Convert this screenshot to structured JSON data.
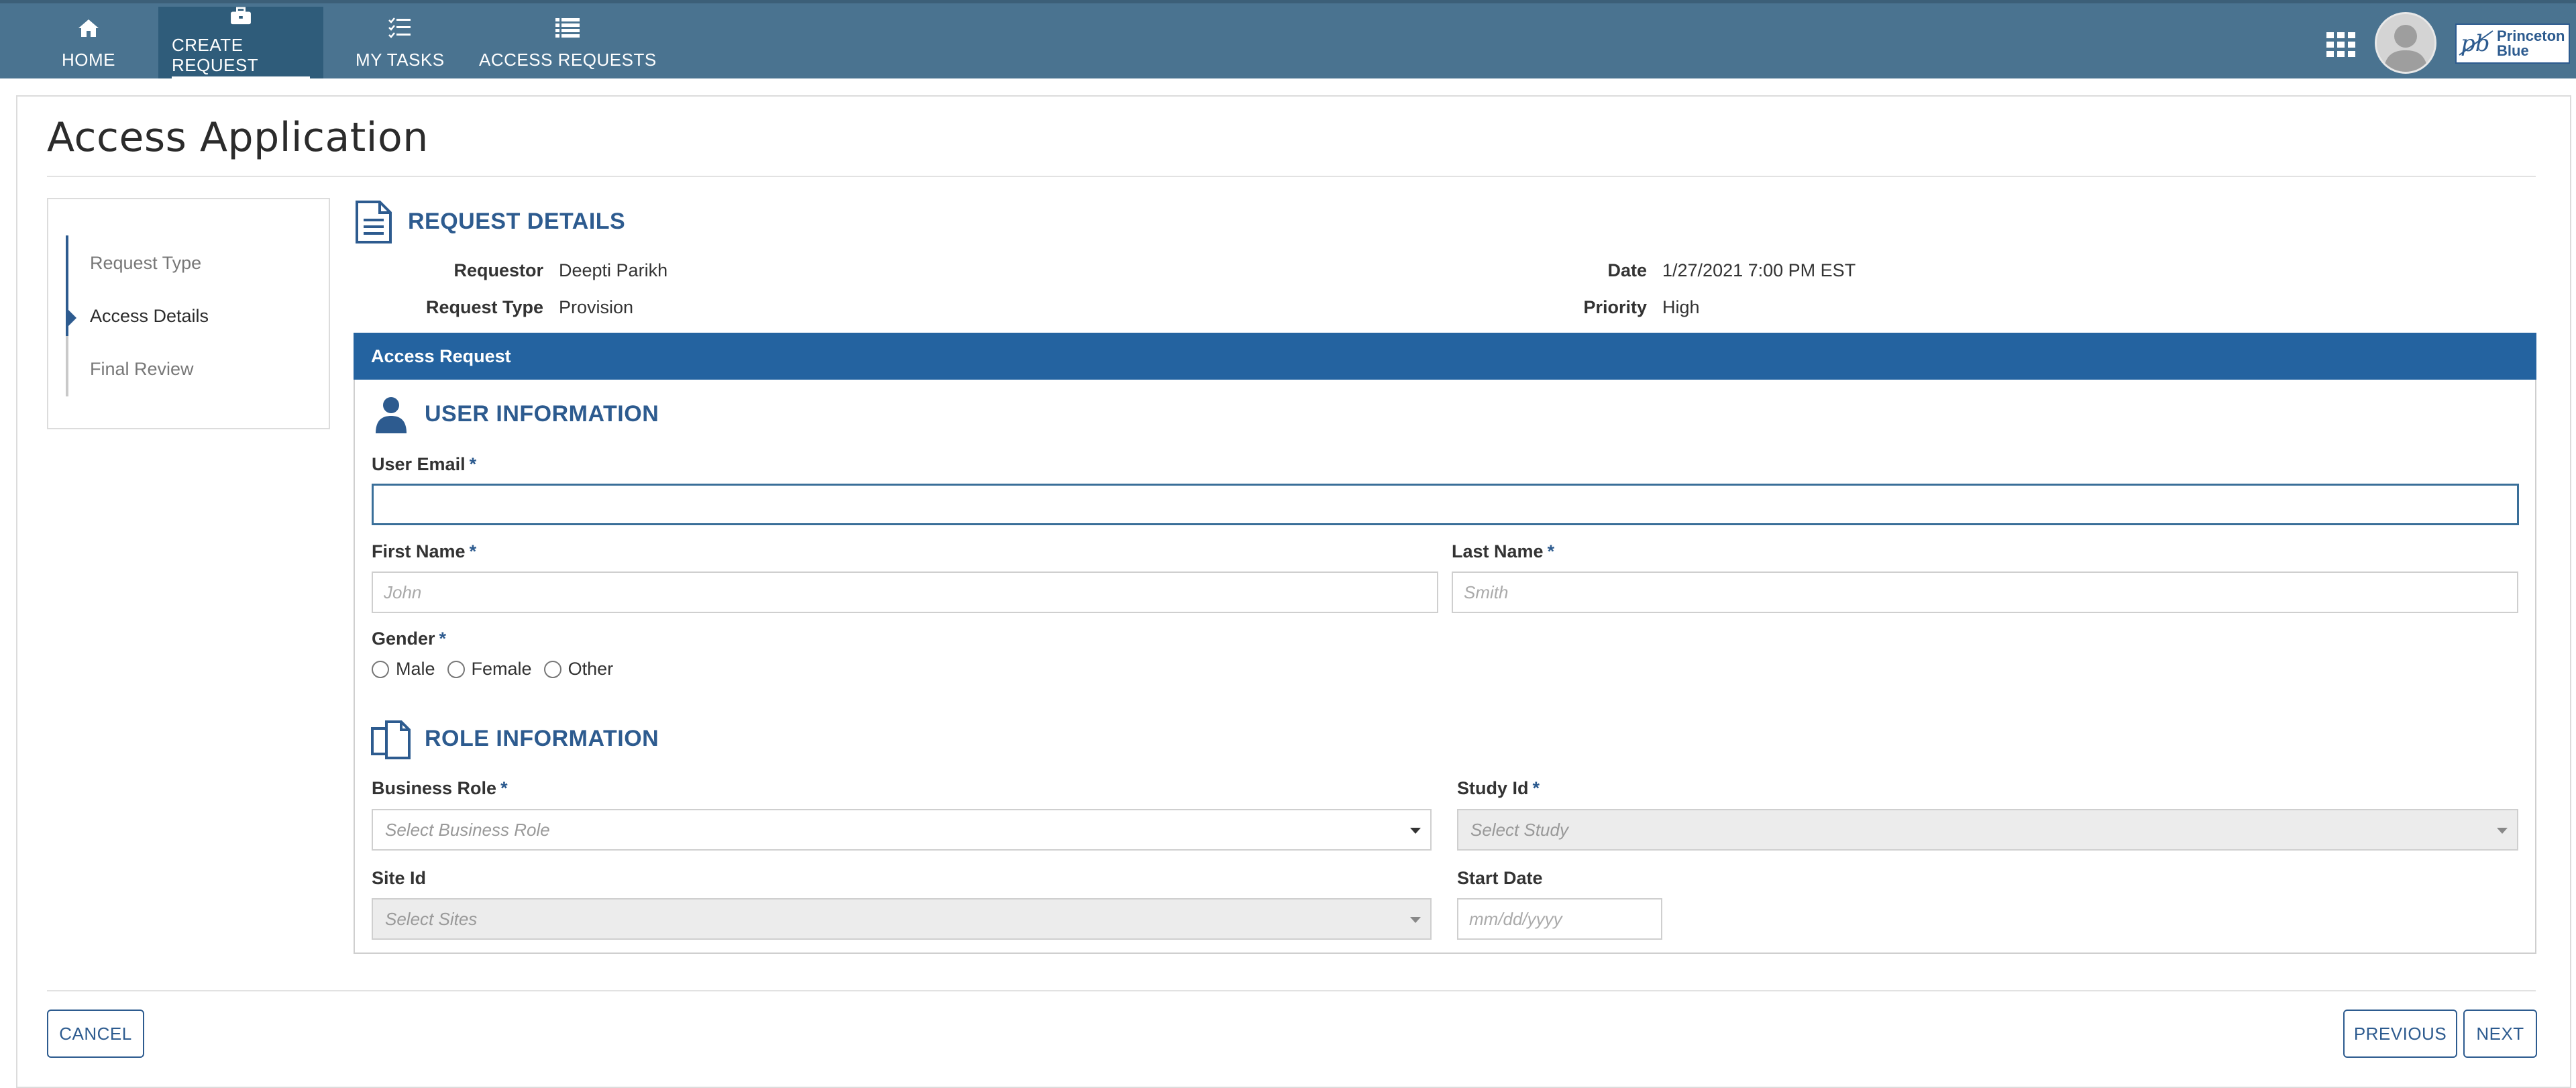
{
  "nav": {
    "items": [
      {
        "label": "HOME",
        "icon": "home-icon"
      },
      {
        "label": "CREATE REQUEST",
        "icon": "briefcase-icon",
        "active": true
      },
      {
        "label": "MY TASKS",
        "icon": "task-list-icon"
      },
      {
        "label": "ACCESS REQUESTS",
        "icon": "list-icon"
      }
    ],
    "logo_text_line1": "Princeton",
    "logo_text_line2": "Blue",
    "logo_mark": "pb",
    "color": "#4a7390",
    "active_color": "#2f5c7a"
  },
  "page": {
    "title": "Access Application"
  },
  "steps": {
    "items": [
      {
        "label": "Request Type"
      },
      {
        "label": "Access Details",
        "current": true
      },
      {
        "label": "Final Review"
      }
    ]
  },
  "request_details": {
    "heading": "REQUEST DETAILS",
    "requestor_label": "Requestor",
    "requestor_value": "Deepti Parikh",
    "request_type_label": "Request Type",
    "request_type_value": "Provision",
    "date_label": "Date",
    "date_value": "1/27/2021 7:00 PM EST",
    "priority_label": "Priority",
    "priority_value": "High"
  },
  "access_request": {
    "panel_title": "Access Request",
    "header_color": "#2463a0"
  },
  "user_information": {
    "heading": "USER INFORMATION",
    "email_label": "User Email",
    "email_value": "",
    "first_name_label": "First Name",
    "first_name_placeholder": "John",
    "last_name_label": "Last Name",
    "last_name_placeholder": "Smith",
    "gender_label": "Gender",
    "gender_options": [
      "Male",
      "Female",
      "Other"
    ],
    "required_marker": "*"
  },
  "role_information": {
    "heading": "ROLE INFORMATION",
    "business_role_label": "Business Role",
    "business_role_placeholder": "Select Business Role",
    "study_id_label": "Study Id",
    "study_id_placeholder": "Select Study",
    "site_id_label": "Site Id",
    "site_id_placeholder": "Select Sites",
    "start_date_label": "Start Date",
    "start_date_placeholder": "mm/dd/yyyy"
  },
  "footer": {
    "cancel_label": "CANCEL",
    "previous_label": "PREVIOUS",
    "next_label": "NEXT"
  },
  "accent_color": "#2d5b8f"
}
